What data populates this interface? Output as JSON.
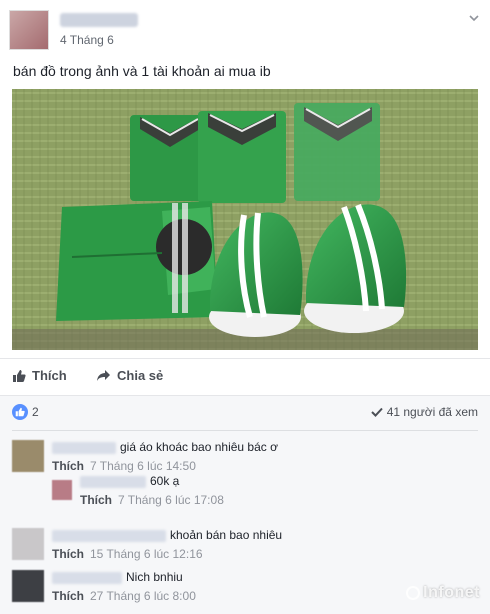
{
  "post": {
    "date": "4 Tháng 6",
    "text": "bán đồ trong ảnh và 1 tài khoản ai mua ib"
  },
  "actions": {
    "like_label": "Thích",
    "share_label": "Chia sẻ"
  },
  "stats": {
    "likes": "2",
    "seen": "41 người đã xem"
  },
  "comments": [
    {
      "text": "giá áo khoác bao nhiêu bác ơ",
      "like": "Thích",
      "time": "7 Tháng 6 lúc 14:50"
    },
    {
      "text": "60k ạ",
      "like": "Thích",
      "time": "7 Tháng 6 lúc 17:08"
    },
    {
      "text": "khoản bán bao nhiêu",
      "like": "Thích",
      "time": "15 Tháng 6 lúc 12:16"
    },
    {
      "text": "Nich bnhiu",
      "like": "Thích",
      "time": "27 Tháng 6 lúc 8:00"
    }
  ],
  "watermark": "Infonet",
  "colors": {
    "grab_green": "#2f9e48",
    "like_blue": "#5890ff",
    "text_muted": "#90949c"
  }
}
